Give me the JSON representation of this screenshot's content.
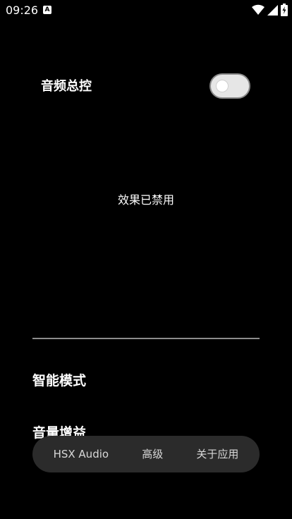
{
  "status_bar": {
    "time": "09:26",
    "notification_glyph": "A"
  },
  "master": {
    "label": "音频总控",
    "enabled": false
  },
  "effect_status": "效果已禁用",
  "sections": {
    "smart_mode": "智能模式",
    "volume_gain": "音量增益"
  },
  "bottom_nav": {
    "items": [
      {
        "label": "HSX Audio"
      },
      {
        "label": "高级"
      },
      {
        "label": "关于应用"
      }
    ]
  },
  "colors": {
    "background": "#000000",
    "nav_background": "#2b2b2b",
    "toggle_track": "#e6e6e6",
    "divider": "#8c8c8c"
  }
}
